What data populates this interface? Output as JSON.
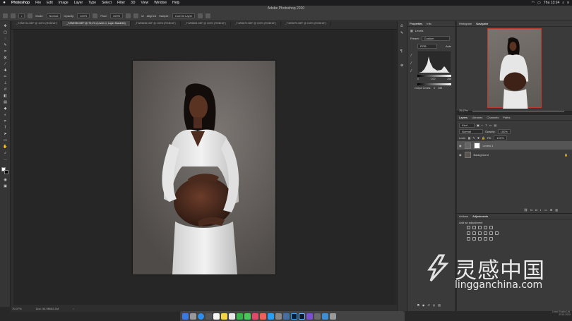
{
  "menubar": {
    "app": "Photoshop",
    "items": [
      "File",
      "Edit",
      "Image",
      "Layer",
      "Type",
      "Select",
      "Filter",
      "3D",
      "View",
      "Window",
      "Help"
    ],
    "clock": "Thu 13:24"
  },
  "window_title": "Adobe Photoshop 2020",
  "options": {
    "mode_label": "Mode:",
    "mode_value": "Normal",
    "opacity_label": "Opacity:",
    "opacity_value": "100%",
    "flow_label": "Flow:",
    "flow_value": "100%",
    "aligned_label": "Aligned",
    "sample_label": "Sample:",
    "sample_value": "Current Layer"
  },
  "tabs": [
    "_TJW5714.NEF @ 100% (RGB/16*)",
    "_TJW5789.NEF @ 70.1% (Levels 1, Layer Mask/16)",
    "_TJW5836.NEF @ 100% (RGB/16*)",
    "_TJW5863.NEF @ 100% (RGB/16*)",
    "_TJW5872.NEF @ 100% (RGB/16*)",
    "_TJW5879.NEF @ 100% (RGB/16*)"
  ],
  "active_tab": 1,
  "status": {
    "zoom": "70.07%",
    "doc": "Doc: 34.9M/83.1M"
  },
  "properties": {
    "tabs": [
      "Properties",
      "Info"
    ],
    "section": "Levels",
    "preset_label": "Preset:",
    "preset_value": "Custom",
    "channel": "RGB",
    "auto_label": "Auto",
    "input_values": [
      "0",
      "1.00",
      "255"
    ],
    "output_label": "Output Levels:",
    "output_values": [
      "0",
      "255"
    ]
  },
  "nav": {
    "tabs": [
      "Histogram",
      "Navigator"
    ],
    "zoom": "70.07%"
  },
  "layers": {
    "tabs": [
      "Layers",
      "Libraries",
      "Channels",
      "Paths"
    ],
    "kind_label": "Kind",
    "blend": "Normal",
    "opacity_label": "Opacity:",
    "opacity_value": "100%",
    "lock_label": "Lock:",
    "fill_label": "Fill:",
    "fill_value": "100%",
    "items": [
      "Levels 1",
      "Background"
    ]
  },
  "adjustments": {
    "tabs": [
      "Actions",
      "Adjustments"
    ],
    "hint": "Add an adjustment"
  },
  "watermark": {
    "cn": "灵感中国",
    "en": "lingganchina.com"
  },
  "corner": {
    "line1": "Linco Studio Ltd.",
    "line2": "2019-2020"
  }
}
